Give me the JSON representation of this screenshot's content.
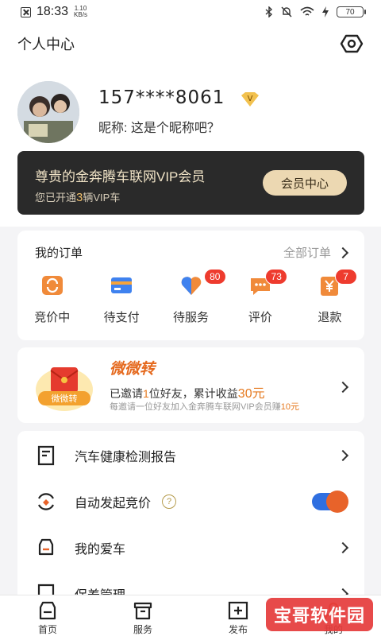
{
  "status_bar": {
    "time": "18:33",
    "speed": "1.10",
    "speed_unit": "KB/s",
    "battery": "70"
  },
  "header": {
    "title": "个人中心"
  },
  "profile": {
    "phone": "157****8061",
    "vip_mark": "V",
    "nickname": "昵称: 这是个昵称吧？"
  },
  "vip_card": {
    "title": "尊贵的金奔腾车联网VIP会员",
    "sub_prefix": "您已开通",
    "count": "3",
    "sub_suffix": "辆VIP车",
    "button": "会员中心"
  },
  "orders": {
    "title": "我的订单",
    "all": "全部订单",
    "items": [
      {
        "label": "竞价中",
        "icon": "bidding-icon",
        "badge": ""
      },
      {
        "label": "待支付",
        "icon": "card-icon",
        "badge": ""
      },
      {
        "label": "待服务",
        "icon": "heart-icon",
        "badge": "80"
      },
      {
        "label": "评价",
        "icon": "chat-icon",
        "badge": "73"
      },
      {
        "label": "退款",
        "icon": "refund-icon",
        "badge": "7"
      }
    ]
  },
  "invite": {
    "brand": "微微转",
    "logo_text": "微微转",
    "line_a": "已邀请",
    "line_b": "1",
    "line_c": "位好友，累计收益",
    "line_d": "30元",
    "sub_a": "每邀请一位好友加入金奔腾车联网VIP会员赚",
    "sub_b": "10元"
  },
  "list": {
    "items": [
      {
        "label": "汽车健康检测报告",
        "icon": "report-icon"
      },
      {
        "label": "自动发起竞价",
        "icon": "auto-bid-icon",
        "help": "?"
      },
      {
        "label": "我的爱车",
        "icon": "car-icon"
      },
      {
        "label": "保养管理",
        "icon": "maintenance-icon"
      }
    ]
  },
  "tabs": [
    {
      "label": "首页",
      "icon": "home-car-icon"
    },
    {
      "label": "服务",
      "icon": "service-icon"
    },
    {
      "label": "发布",
      "icon": "publish-icon"
    },
    {
      "label": "我的",
      "icon": "profile-icon"
    }
  ],
  "watermark": "宝哥软件园",
  "colors": {
    "accent": "#2f6fe0",
    "badge": "#ee3b2e",
    "gold": "#ecd8b2",
    "orange": "#e5791f"
  }
}
